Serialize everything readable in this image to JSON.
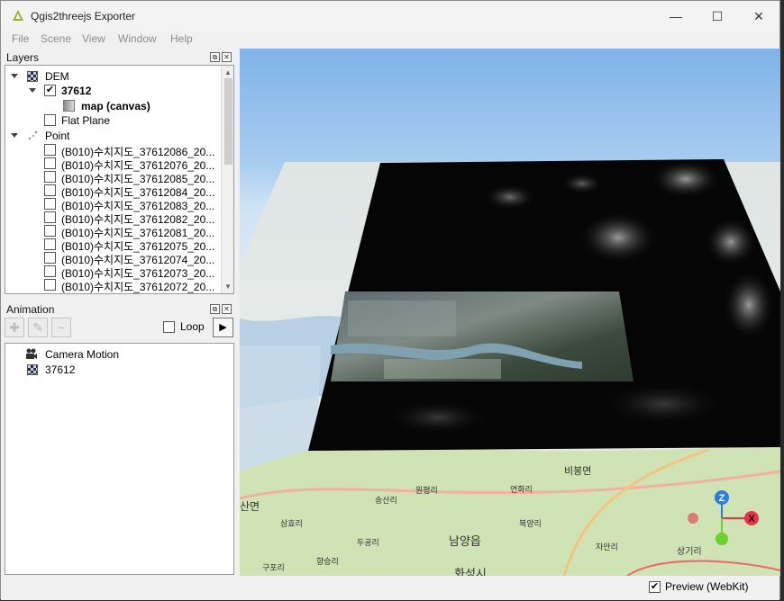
{
  "window": {
    "title": "Qgis2threejs Exporter",
    "minimize_glyph": "—",
    "maximize_glyph": "☐",
    "close_glyph": "✕"
  },
  "menu": [
    "File",
    "Scene",
    "View",
    "Window",
    "Help"
  ],
  "layers_dock": {
    "title": "Layers",
    "float_glyph": "⧉",
    "close_glyph": "✕",
    "groups": {
      "dem": {
        "label": "DEM",
        "icon": "raster-icon"
      },
      "dem_child": {
        "label": "37612",
        "checked": true
      },
      "map_canvas": {
        "label": "map (canvas)",
        "icon": "map-icon"
      },
      "flat_plane": {
        "label": "Flat Plane",
        "checked": false
      },
      "point": {
        "label": "Point",
        "icon": "point-icon"
      }
    },
    "point_layers": [
      "(B010)수치지도_37612086_20...",
      "(B010)수치지도_37612076_20...",
      "(B010)수치지도_37612085_20...",
      "(B010)수치지도_37612084_20...",
      "(B010)수치지도_37612083_20...",
      "(B010)수치지도_37612082_20...",
      "(B010)수치지도_37612081_20...",
      "(B010)수치지도_37612075_20...",
      "(B010)수치지도_37612074_20...",
      "(B010)수치지도_37612073_20...",
      "(B010)수치지도_37612072_20..."
    ]
  },
  "animation_dock": {
    "title": "Animation",
    "add_glyph": "✚",
    "edit_glyph": "✎",
    "remove_glyph": "−",
    "loop_label": "Loop",
    "loop_checked": false,
    "play_glyph": "▶",
    "items": [
      {
        "label": "Camera Motion",
        "icon": "camera-icon"
      },
      {
        "label": "37612",
        "icon": "raster-icon"
      }
    ]
  },
  "map_labels": {
    "l1": "비봉면",
    "l2": "산면",
    "l3": "남양읍",
    "l4": "화성시",
    "l5": "삼효리",
    "l6": "두공리",
    "l7": "자안리",
    "l8": "상기리",
    "l9": "향승리",
    "l10": "원평리",
    "l11": "북양리",
    "l12": "구포리",
    "l13": "송산리",
    "l14": "연화리"
  },
  "axes": {
    "z": "Z",
    "x": "X"
  },
  "status": {
    "preview_label": "Preview (WebKit)",
    "preview_checked": true,
    "check_glyph": "✔"
  },
  "colors": {
    "axis_x": "#e8334a",
    "axis_z": "#2a7de1",
    "axis_y": "#6cd12b",
    "sky": "#8fbdec"
  }
}
